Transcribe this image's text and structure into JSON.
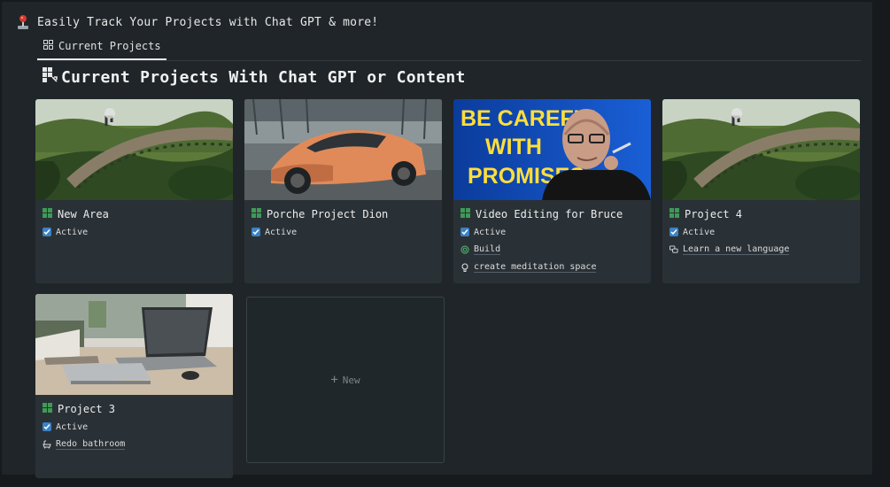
{
  "header": {
    "title": "Easily Track Your Projects with Chat GPT & more!"
  },
  "tabs": [
    {
      "label": "Current Projects"
    }
  ],
  "section": {
    "title": "Current Projects With Chat GPT or Content"
  },
  "cards": [
    {
      "title": "New Area",
      "status": "Active",
      "image": "railway-viaduct-landscape"
    },
    {
      "title": "Porche Project Dion",
      "status": "Active",
      "image": "orange-sports-car"
    },
    {
      "title": "Video Editing for Bruce",
      "status": "Active",
      "image": "be-careful-with-promises-thumbnail",
      "image_text": [
        "BE CAREFUL",
        "WITH",
        "PROMISES"
      ],
      "extra1": "Build",
      "extra2": "create meditation space"
    },
    {
      "title": "Project 4",
      "status": "Active",
      "image": "railway-viaduct-landscape",
      "extra1": "Learn a new language"
    },
    {
      "title": "Project 3",
      "status": "Active",
      "image": "desk-with-laptop",
      "extra1": "Redo bathroom"
    }
  ],
  "new_card": {
    "label": "New"
  },
  "colors": {
    "background": "#1f2528",
    "card": "#2a3136",
    "checkbox": "#3b82c4",
    "project_icon": "#3f9a56",
    "thumbnail_text": "#ffde3a"
  }
}
